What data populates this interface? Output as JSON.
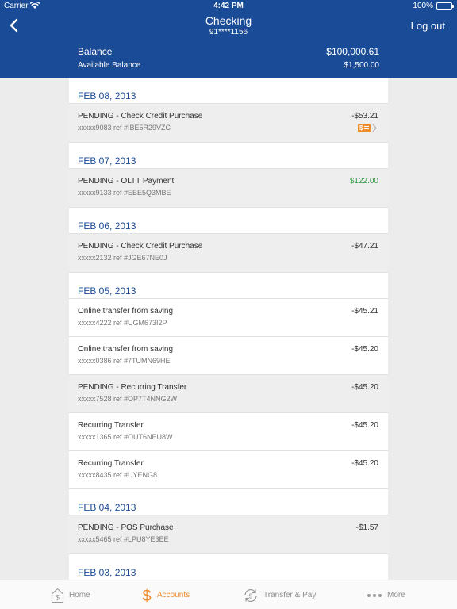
{
  "status_bar": {
    "carrier": "Carrier",
    "time": "4:42 PM",
    "battery": "100%"
  },
  "nav": {
    "title": "Checking",
    "account_number": "91****1156",
    "logout_label": "Log out"
  },
  "balance": {
    "label": "Balance",
    "value": "$100,000.61",
    "available_label": "Available Balance",
    "available_value": "$1,500.00"
  },
  "groups": [
    {
      "date": "FEB 08, 2013",
      "items": [
        {
          "desc": "PENDING - Check Credit Purchase",
          "ref": "xxxxx9083 ref #IBE5R29VZC",
          "amount": "-$53.21",
          "pending": true,
          "has_check": true
        }
      ]
    },
    {
      "date": "FEB 07, 2013",
      "items": [
        {
          "desc": "PENDING - OLTT Payment",
          "ref": "xxxxx9133 ref #EBE5Q3MBE",
          "amount": "$122.00",
          "pending": true,
          "positive": true
        }
      ]
    },
    {
      "date": "FEB 06, 2013",
      "items": [
        {
          "desc": "PENDING - Check Credit Purchase",
          "ref": "xxxxx2132 ref #JGE67NE0J",
          "amount": "-$47.21",
          "pending": true
        }
      ]
    },
    {
      "date": "FEB 05, 2013",
      "items": [
        {
          "desc": "Online transfer from saving",
          "ref": "xxxxx4222 ref #UGM673I2P",
          "amount": "-$45.21",
          "pending": false
        },
        {
          "desc": "Online transfer from saving",
          "ref": "xxxxx0386 ref #7TUMN69HE",
          "amount": "-$45.20",
          "pending": false
        },
        {
          "desc": "PENDING - Recurring Transfer",
          "ref": "xxxxx7528 ref #OP7T4NNG2W",
          "amount": "-$45.20",
          "pending": true
        },
        {
          "desc": "Recurring Transfer",
          "ref": "xxxxx1365 ref #OUT6NEU8W",
          "amount": "-$45.20",
          "pending": false
        },
        {
          "desc": "Recurring Transfer",
          "ref": "xxxxx8435 ref #UYENG8",
          "amount": "-$45.20",
          "pending": false
        }
      ]
    },
    {
      "date": "FEB 04, 2013",
      "items": [
        {
          "desc": "PENDING - POS Purchase",
          "ref": "xxxxx5465 ref #LPU8YE3EE",
          "amount": "-$1.57",
          "pending": true
        }
      ]
    },
    {
      "date": "FEB 03, 2013",
      "items": []
    }
  ],
  "tabs": [
    {
      "label": "Home",
      "icon": "home-icon"
    },
    {
      "label": "Accounts",
      "icon": "dollar-icon",
      "active": true
    },
    {
      "label": "Transfer & Pay",
      "icon": "transfer-icon"
    },
    {
      "label": "More",
      "icon": "more-icon"
    }
  ],
  "colors": {
    "header": "#1a4b96",
    "accent": "#f08c2b",
    "positive": "#2f9d3e"
  }
}
